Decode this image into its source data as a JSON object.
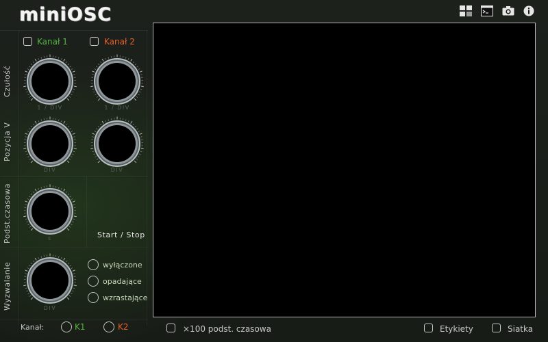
{
  "app": {
    "title": "miniOSC"
  },
  "toolbar": {
    "icons": [
      "layout-icon",
      "terminal-icon",
      "camera-icon",
      "info-icon"
    ]
  },
  "channels": {
    "ch1_label": "Kanał 1",
    "ch2_label": "Kanał 2"
  },
  "sections": {
    "sensitivity": "Czułość",
    "position": "Pozycja V",
    "timebase": "Podst.czasowa",
    "trigger": "Wyzwalanie"
  },
  "units": {
    "sens_ch1": "1 / DIV",
    "sens_ch2": "1 / DIV",
    "pos_ch1": "DIV",
    "pos_ch2": "DIV",
    "timebase": "s",
    "trigger": "DIV"
  },
  "start_stop": "Start / Stop",
  "trigger_modes": [
    "wyłączone",
    "opadające",
    "wzrastające"
  ],
  "trigger_channel": {
    "label": "Kanał:",
    "k1": "K1",
    "k2": "K2"
  },
  "bottom": {
    "x100": "×100 podst. czasowa",
    "labels": "Etykiety",
    "grid": "Siatka"
  },
  "colors": {
    "channel1": "#56b144",
    "channel2": "#e8602c",
    "screen": "#000000"
  }
}
